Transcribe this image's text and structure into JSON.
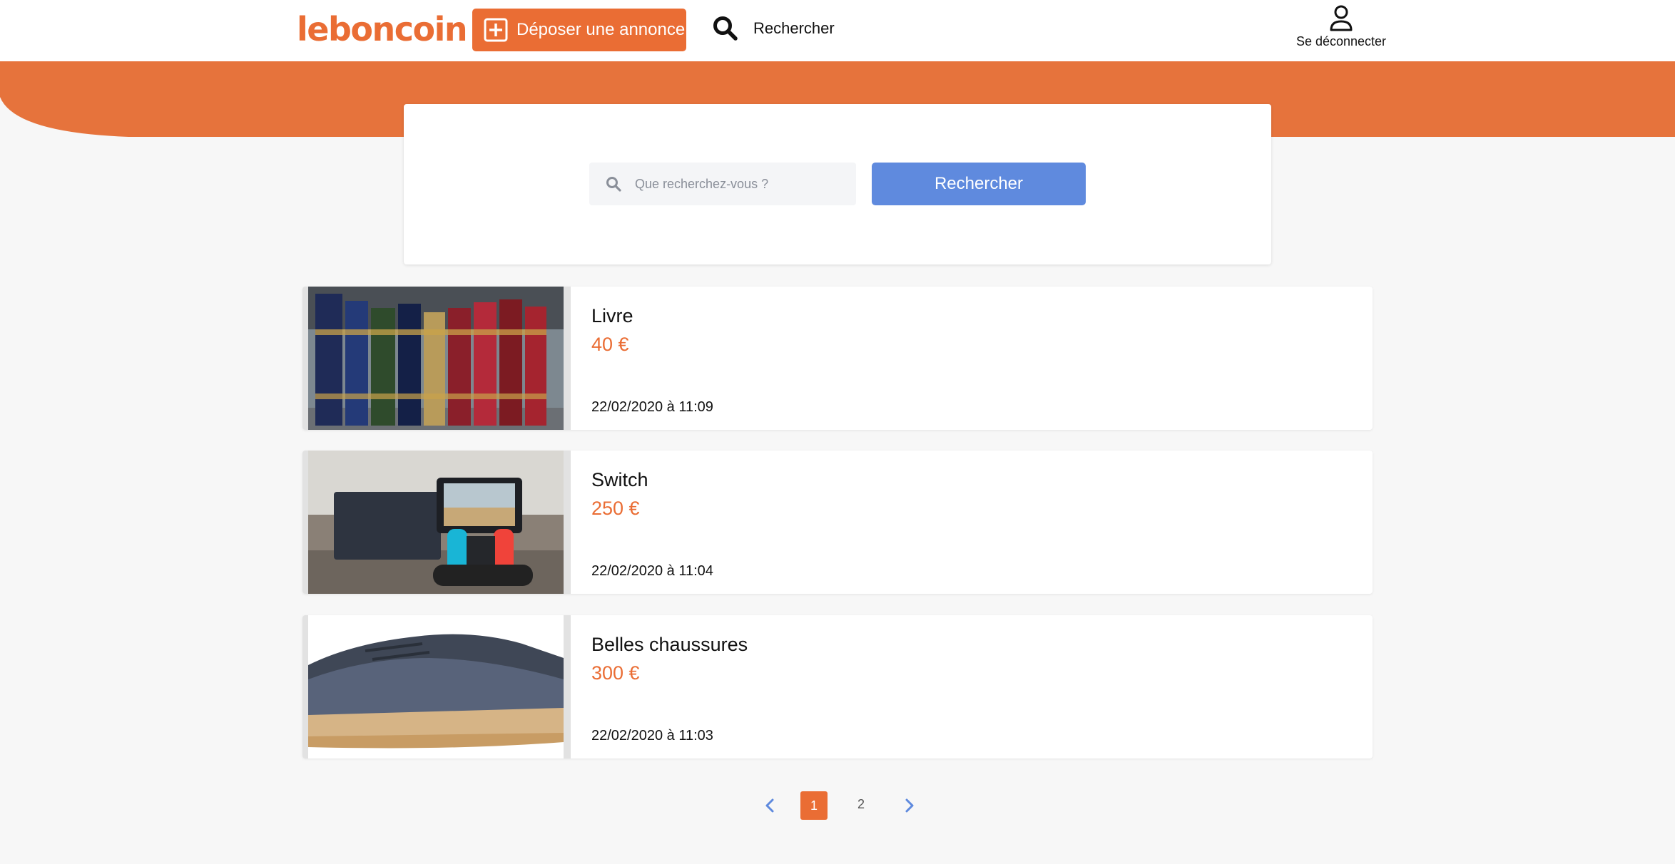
{
  "header": {
    "logo_text": "leboncoin",
    "post_button_label": "Déposer une annonce",
    "search_link_label": "Rechercher",
    "logout_label": "Se déconnecter"
  },
  "search": {
    "placeholder": "Que recherchez-vous ?",
    "button_label": "Rechercher"
  },
  "listings": [
    {
      "title": "Livre",
      "price": "40 €",
      "date": "22/02/2020 à 11:09",
      "image": "books-photo"
    },
    {
      "title": "Switch",
      "price": "250 €",
      "date": "22/02/2020 à 11:04",
      "image": "console-photo"
    },
    {
      "title": "Belles chaussures",
      "price": "300 €",
      "date": "22/02/2020 à 11:03",
      "image": "sneaker-photo"
    }
  ],
  "pagination": {
    "pages": [
      "1",
      "2"
    ],
    "current": "1"
  },
  "colors": {
    "brand": "#ea6d34",
    "search_button": "#5f8ade",
    "background": "#f7f7f7"
  },
  "icons": {
    "plus": "plus-square-icon",
    "search": "search-icon",
    "user": "user-icon",
    "prev": "chevron-left-icon",
    "next": "chevron-right-icon"
  }
}
